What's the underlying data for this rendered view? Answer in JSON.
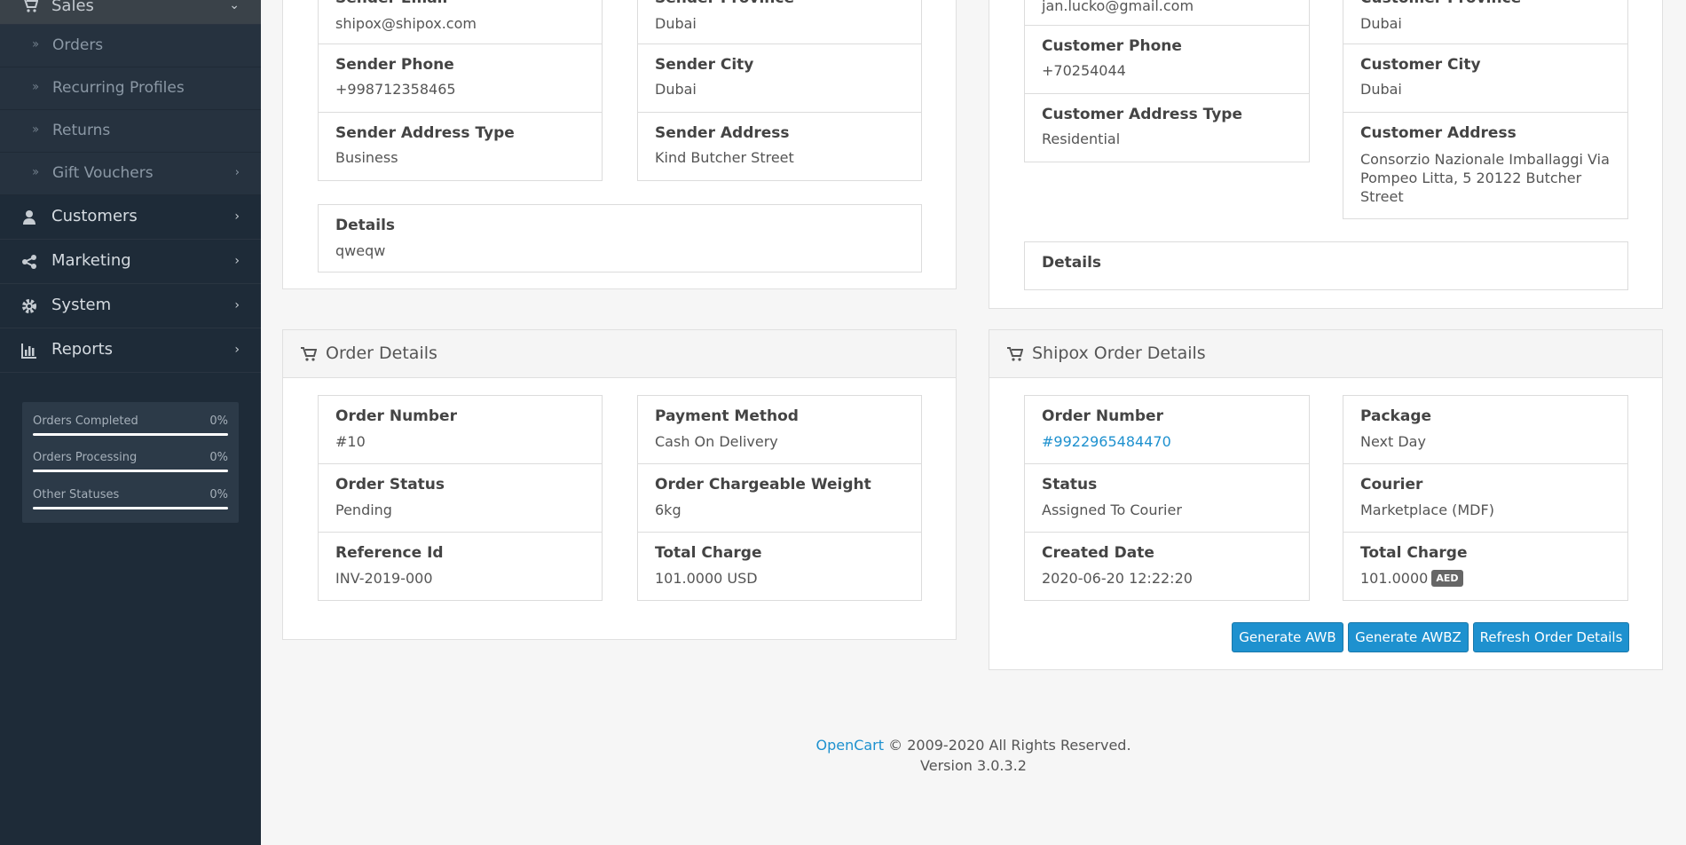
{
  "sidebar": {
    "sales": "Sales",
    "sub_items": [
      {
        "label": "Orders"
      },
      {
        "label": "Recurring Profiles"
      },
      {
        "label": "Returns"
      },
      {
        "label": "Gift Vouchers"
      }
    ],
    "nav": [
      {
        "label": "Customers",
        "icon": "user-icon"
      },
      {
        "label": "Marketing",
        "icon": "share-icon"
      },
      {
        "label": "System",
        "icon": "gear-icon"
      },
      {
        "label": "Reports",
        "icon": "bar-chart-icon"
      }
    ],
    "stats": [
      {
        "name": "Orders Completed",
        "pct": "0%"
      },
      {
        "name": "Orders Processing",
        "pct": "0%"
      },
      {
        "name": "Other Statuses",
        "pct": "0%"
      }
    ]
  },
  "sender": {
    "email_label": "Sender Email",
    "email": "shipox@shipox.com",
    "province_label": "Sender Province",
    "province": "Dubai",
    "phone_label": "Sender Phone",
    "phone": "+998712358465",
    "city_label": "Sender City",
    "city": "Dubai",
    "address_type_label": "Sender Address Type",
    "address_type": "Business",
    "address_label": "Sender Address",
    "address": "Kind Butcher Street",
    "details_label": "Details",
    "details": "qweqw"
  },
  "customer": {
    "email": "jan.lucko@gmail.com",
    "province_label": "Customer Province",
    "province": "Dubai",
    "phone_label": "Customer Phone",
    "phone": "+70254044",
    "city_label": "Customer City",
    "city": "Dubai",
    "address_type_label": "Customer Address Type",
    "address_type": "Residential",
    "address_label": "Customer Address",
    "address": "Consorzio Nazionale Imballaggi Via Pompeo Litta, 5 20122 Butcher Street",
    "details_label": "Details"
  },
  "order_details": {
    "title": "Order Details",
    "order_number_label": "Order Number",
    "order_number": "#10",
    "payment_method_label": "Payment Method",
    "payment_method": "Cash On Delivery",
    "order_status_label": "Order Status",
    "order_status": "Pending",
    "weight_label": "Order Chargeable Weight",
    "weight": "6kg",
    "reference_label": "Reference Id",
    "reference": "INV-2019-000",
    "total_label": "Total Charge",
    "total": "101.0000 USD"
  },
  "shipox": {
    "title": "Shipox Order Details",
    "order_number_label": "Order Number",
    "order_number": "#9922965484470",
    "package_label": "Package",
    "package": "Next Day",
    "status_label": "Status",
    "status": "Assigned To Courier",
    "courier_label": "Courier",
    "courier": "Marketplace (MDF)",
    "created_label": "Created Date",
    "created": "2020-06-20 12:22:20",
    "total_label": "Total Charge",
    "total": "101.0000",
    "currency": "AED",
    "buttons": {
      "awb": "Generate AWB",
      "awbz": "Generate AWBZ",
      "refresh": "Refresh Order Details"
    }
  },
  "footer": {
    "brand": "OpenCart",
    "copyright": " © 2009-2020 All Rights Reserved.",
    "version": "Version 3.0.3.2"
  }
}
